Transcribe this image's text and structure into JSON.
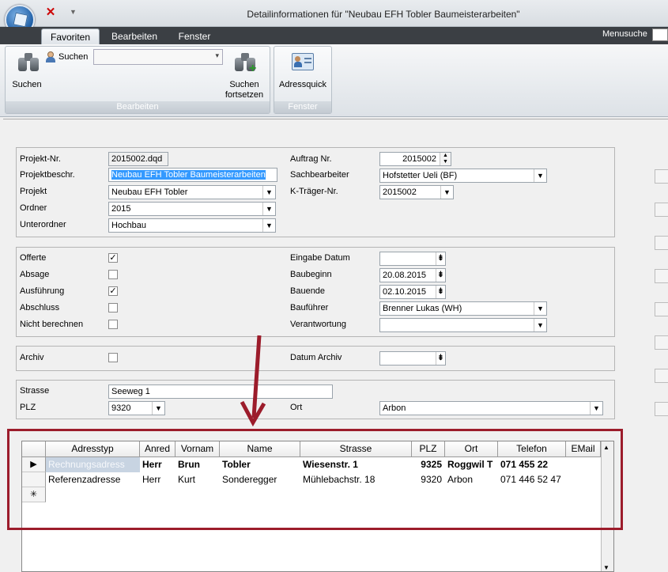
{
  "window": {
    "title": "Detailinformationen für \"Neubau EFH Tobler Baumeisterarbeiten\""
  },
  "tabs": [
    {
      "label": "Favoriten",
      "active": true
    },
    {
      "label": "Bearbeiten",
      "active": false
    },
    {
      "label": "Fenster",
      "active": false
    }
  ],
  "menusuche": {
    "label": "Menusuche",
    "value": ""
  },
  "ribbon": {
    "group_bearbeiten": {
      "label": "Bearbeiten",
      "search_button": "Suchen",
      "search_combo_label": "Suchen",
      "search_combo_value": "",
      "search_next_line1": "Suchen",
      "search_next_line2": "fortsetzen"
    },
    "group_fenster": {
      "label": "Fenster",
      "adressquick": "Adressquick"
    }
  },
  "project": {
    "projekt_nr_label": "Projekt-Nr.",
    "projekt_nr": "2015002.dqd",
    "projektbeschr_label": "Projektbeschr.",
    "projektbeschr": "Neubau EFH Tobler Baumeisterarbeiten",
    "projekt_label": "Projekt",
    "projekt": "Neubau EFH Tobler",
    "ordner_label": "Ordner",
    "ordner": "2015",
    "unterordner_label": "Unterordner",
    "unterordner": "Hochbau",
    "auftrag_nr_label": "Auftrag Nr.",
    "auftrag_nr": "2015002",
    "sachbearbeiter_label": "Sachbearbeiter",
    "sachbearbeiter": "Hofstetter Ueli (BF)",
    "ktraeger_label": "K-Träger-Nr.",
    "ktraeger": "2015002"
  },
  "status": {
    "offerte_label": "Offerte",
    "offerte": true,
    "absage_label": "Absage",
    "absage": false,
    "ausfuehrung_label": "Ausführung",
    "ausfuehrung": true,
    "abschluss_label": "Abschluss",
    "abschluss": false,
    "nicht_berechnen_label": "Nicht berechnen",
    "nicht_berechnen": false,
    "eingabe_datum_label": "Eingabe Datum",
    "eingabe_datum": "",
    "baubeginn_label": "Baubeginn",
    "baubeginn": "20.08.2015",
    "bauende_label": "Bauende",
    "bauende": "02.10.2015",
    "bauführer_label": "Bauführer",
    "bauführer": "Brenner Lukas (WH)",
    "verantwortung_label": "Verantwortung",
    "verantwortung": ""
  },
  "archiv": {
    "archiv_label": "Archiv",
    "archiv": false,
    "datum_archiv_label": "Datum Archiv",
    "datum_archiv": ""
  },
  "address": {
    "strasse_label": "Strasse",
    "strasse": "Seeweg 1",
    "plz_label": "PLZ",
    "plz": "9320",
    "ort_label": "Ort",
    "ort": "Arbon"
  },
  "grid": {
    "columns": [
      "Adresstyp",
      "Anred",
      "Vornam",
      "Name",
      "Strasse",
      "PLZ",
      "Ort",
      "Telefon",
      "EMail"
    ],
    "rows": [
      [
        "Rechnungsadress",
        "Herr",
        "Brun",
        "Tobler",
        "Wiesenstr. 1",
        "9325",
        "Roggwil T",
        "071 455 22",
        ""
      ],
      [
        "Referenzadresse",
        "Herr",
        "Kurt",
        "Sonderegger",
        "Mühlebachstr. 18",
        "9320",
        "Arbon",
        "071 446 52 47",
        ""
      ]
    ],
    "row_markers": [
      "▶",
      "",
      "✳"
    ]
  },
  "colors": {
    "highlight": "#9c1c2b",
    "selection": "#3399ff"
  }
}
